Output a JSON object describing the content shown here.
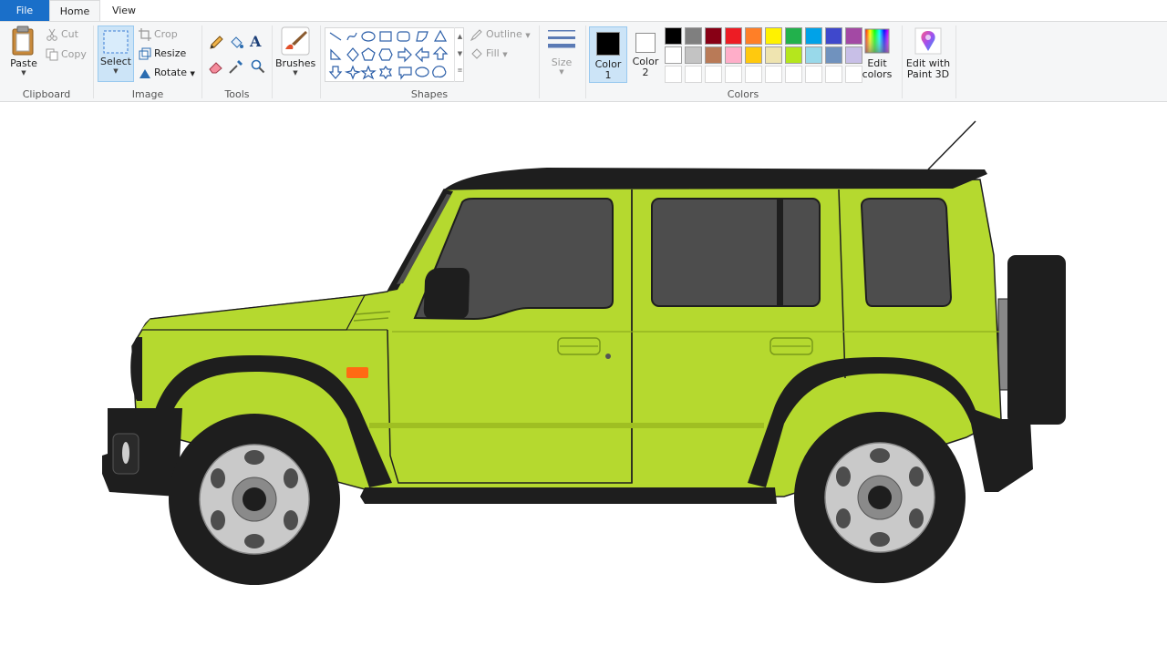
{
  "tabs": {
    "file": "File",
    "home": "Home",
    "view": "View"
  },
  "clipboard": {
    "paste": "Paste",
    "cut": "Cut",
    "copy": "Copy",
    "label": "Clipboard"
  },
  "image": {
    "select": "Select",
    "crop": "Crop",
    "resize": "Resize",
    "rotate": "Rotate",
    "label": "Image"
  },
  "tools": {
    "label": "Tools"
  },
  "brushes": {
    "label": "Brushes"
  },
  "shapes": {
    "label": "Shapes",
    "outline": "Outline",
    "fill": "Fill"
  },
  "size": {
    "label": "Size"
  },
  "colors": {
    "color1_line1": "Color",
    "color1_line2": "1",
    "color2_line1": "Color",
    "color2_line2": "2",
    "edit_line1": "Edit",
    "edit_line2": "colors",
    "paint3d_line1": "Edit with",
    "paint3d_line2": "Paint 3D",
    "label": "Colors",
    "color1_value": "#000000",
    "color2_value": "#ffffff",
    "palette_row1": [
      "#000000",
      "#7f7f7f",
      "#880015",
      "#ed1c24",
      "#ff7f27",
      "#fff200",
      "#22b14c",
      "#00a2e8",
      "#3f48cc",
      "#a349a4"
    ],
    "palette_row2": [
      "#ffffff",
      "#c3c3c3",
      "#b97a57",
      "#ffaec9",
      "#ffc90e",
      "#efe4b0",
      "#b5e61d",
      "#99d9ea",
      "#7092be",
      "#c8bfe7"
    ]
  },
  "drawing": {
    "body_color": "#b5d92f",
    "trim_color": "#1e1e1e",
    "glass_color": "#4d4d4d",
    "wheel_color": "#c9c9c9",
    "indicator_color": "#ff6a13"
  }
}
